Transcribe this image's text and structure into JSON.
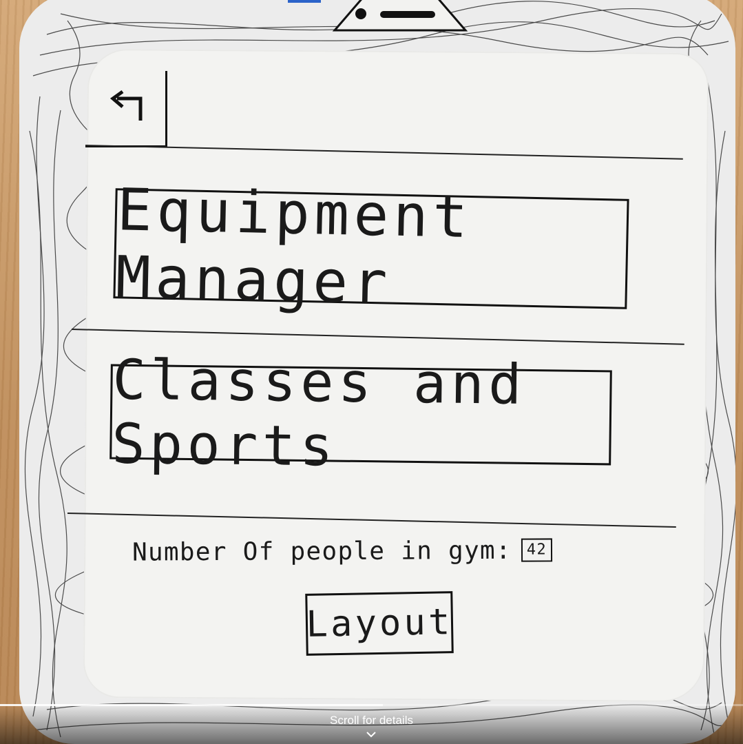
{
  "app": {
    "back_icon": "back-arrow-icon"
  },
  "buttons": {
    "equipment_manager": "Equipment Manager",
    "classes_and_sports": "Classes and Sports",
    "layout": "Layout"
  },
  "gym_status": {
    "label": "Number Of people in gym:",
    "count": "42"
  },
  "video_overlay": {
    "scroll_hint": "Scroll for details",
    "chevron_icon": "chevron-down-icon",
    "progress": 0.515
  },
  "colors": {
    "ink": "#1a1a1a",
    "paper": "#f3f3f1",
    "table": "#c89b68",
    "progress_accent": "#2b63c9"
  }
}
